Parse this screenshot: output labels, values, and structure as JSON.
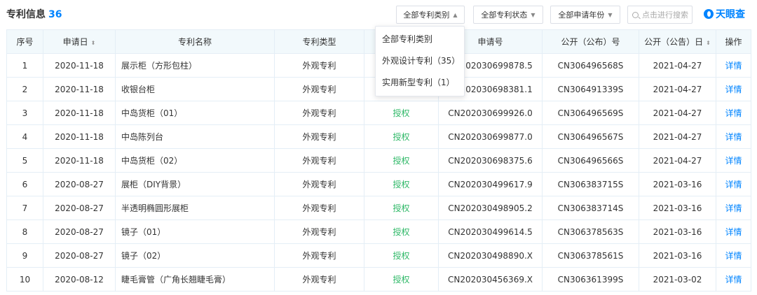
{
  "header": {
    "title": "专利信息",
    "count": "36",
    "filters": [
      {
        "label": "全部专利类别",
        "arrow": "▲"
      },
      {
        "label": "全部专利状态",
        "arrow": "▼"
      },
      {
        "label": "全部申请年份",
        "arrow": "▼"
      }
    ],
    "search_placeholder": "点击进行搜索",
    "logo_text": "天眼查"
  },
  "dropdown": {
    "items": [
      "全部专利类别",
      "外观设计专利（35）",
      "实用新型专利（1）"
    ]
  },
  "table": {
    "columns": [
      "序号",
      "申请日",
      "专利名称",
      "专利类型",
      "",
      "申请号",
      "公开（公布）号",
      "公开（公告）日",
      "操作"
    ],
    "sort_icon": "⬍",
    "rows": [
      {
        "no": "1",
        "date": "2020-11-18",
        "name": "展示柜（方形包柱）",
        "type": "外观专利",
        "status": "",
        "app_no": "CN202030699878.5",
        "pub_no": "CN306496568S",
        "pub_date": "2021-04-27",
        "action": "详情"
      },
      {
        "no": "2",
        "date": "2020-11-18",
        "name": "收银台柜",
        "type": "外观专利",
        "status": "",
        "app_no": "CN202030698381.1",
        "pub_no": "CN306491339S",
        "pub_date": "2021-04-27",
        "action": "详情"
      },
      {
        "no": "3",
        "date": "2020-11-18",
        "name": "中岛货柜（01）",
        "type": "外观专利",
        "status": "授权",
        "app_no": "CN202030699926.0",
        "pub_no": "CN306496569S",
        "pub_date": "2021-04-27",
        "action": "详情"
      },
      {
        "no": "4",
        "date": "2020-11-18",
        "name": "中岛陈列台",
        "type": "外观专利",
        "status": "授权",
        "app_no": "CN202030699877.0",
        "pub_no": "CN306496567S",
        "pub_date": "2021-04-27",
        "action": "详情"
      },
      {
        "no": "5",
        "date": "2020-11-18",
        "name": "中岛货柜（02）",
        "type": "外观专利",
        "status": "授权",
        "app_no": "CN202030698375.6",
        "pub_no": "CN306496566S",
        "pub_date": "2021-04-27",
        "action": "详情"
      },
      {
        "no": "6",
        "date": "2020-08-27",
        "name": "展柜（DIY背景）",
        "type": "外观专利",
        "status": "授权",
        "app_no": "CN202030499617.9",
        "pub_no": "CN306383715S",
        "pub_date": "2021-03-16",
        "action": "详情"
      },
      {
        "no": "7",
        "date": "2020-08-27",
        "name": "半透明椭圆形展柜",
        "type": "外观专利",
        "status": "授权",
        "app_no": "CN202030498905.2",
        "pub_no": "CN306383714S",
        "pub_date": "2021-03-16",
        "action": "详情"
      },
      {
        "no": "8",
        "date": "2020-08-27",
        "name": "镜子（01）",
        "type": "外观专利",
        "status": "授权",
        "app_no": "CN202030499614.5",
        "pub_no": "CN306378563S",
        "pub_date": "2021-03-16",
        "action": "详情"
      },
      {
        "no": "9",
        "date": "2020-08-27",
        "name": "镜子（02）",
        "type": "外观专利",
        "status": "授权",
        "app_no": "CN202030498890.X",
        "pub_no": "CN306378561S",
        "pub_date": "2021-03-16",
        "action": "详情"
      },
      {
        "no": "10",
        "date": "2020-08-12",
        "name": "睫毛膏管（广角长翘睫毛膏）",
        "type": "外观专利",
        "status": "授权",
        "app_no": "CN202030456369.X",
        "pub_no": "CN306361399S",
        "pub_date": "2021-03-02",
        "action": "详情"
      }
    ]
  },
  "colors": {
    "accent": "#0084ff",
    "status_green": "#2eb867",
    "header_bg": "#f2f9fc"
  }
}
